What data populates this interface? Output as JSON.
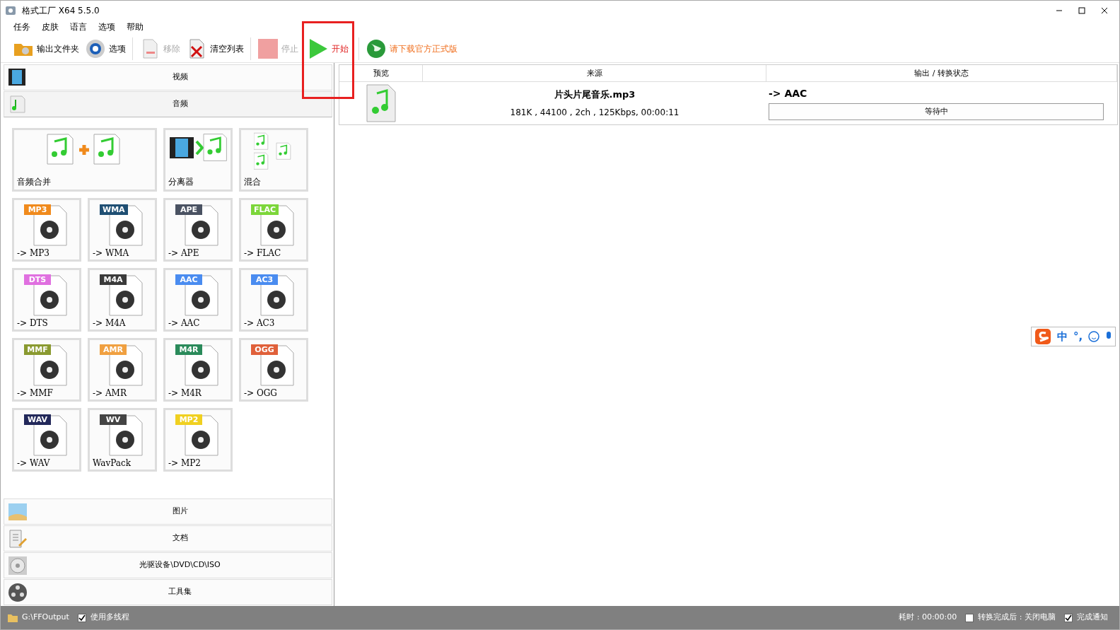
{
  "window": {
    "title": "格式工厂 X64 5.5.0"
  },
  "menu": [
    "任务",
    "皮肤",
    "语言",
    "选项",
    "帮助"
  ],
  "toolbar": [
    {
      "kind": "folder",
      "label": "输出文件夹",
      "disabled": false,
      "highlighted": false
    },
    {
      "kind": "gear",
      "label": "选项",
      "disabled": false,
      "highlighted": false
    },
    {
      "kind": "sep"
    },
    {
      "kind": "remove",
      "label": "移除",
      "disabled": true,
      "highlighted": false
    },
    {
      "kind": "clear",
      "label": "清空列表",
      "disabled": false,
      "highlighted": false
    },
    {
      "kind": "sep"
    },
    {
      "kind": "stop",
      "label": "停止",
      "disabled": true,
      "highlighted": false
    },
    {
      "kind": "start",
      "label": "开始",
      "disabled": false,
      "highlighted": true
    },
    {
      "kind": "sep"
    },
    {
      "kind": "globe",
      "label": "请下载官方正式版",
      "disabled": false,
      "highlighted": false
    }
  ],
  "sidebar": {
    "top_categories": [
      {
        "kind": "video",
        "label": "视频",
        "expanded": false
      },
      {
        "kind": "audio",
        "label": "音频",
        "expanded": true
      }
    ],
    "tiles": [
      {
        "kind": "merge",
        "label": "音频合并"
      },
      {
        "kind": "split",
        "label": "分离器"
      },
      {
        "kind": "mix",
        "label": "混合"
      },
      {
        "kind": "format",
        "label": "-> MP3",
        "badge": "MP3",
        "color": "#f08a1c"
      },
      {
        "kind": "format",
        "label": "-> WMA",
        "badge": "WMA",
        "color": "#1f4f73"
      },
      {
        "kind": "format",
        "label": "-> APE",
        "badge": "APE",
        "color": "#4a5262"
      },
      {
        "kind": "format",
        "label": "-> FLAC",
        "badge": "FLAC",
        "color": "#7cd63a"
      },
      {
        "kind": "format",
        "label": "-> DTS",
        "badge": "DTS",
        "color": "#e070e0"
      },
      {
        "kind": "format",
        "label": "-> M4A",
        "badge": "M4A",
        "color": "#3a3a3a"
      },
      {
        "kind": "format",
        "label": "-> AAC",
        "badge": "AAC",
        "color": "#4a8cf0"
      },
      {
        "kind": "format",
        "label": "-> AC3",
        "badge": "AC3",
        "color": "#4a8cf0"
      },
      {
        "kind": "format",
        "label": "-> MMF",
        "badge": "MMF",
        "color": "#8a9a30"
      },
      {
        "kind": "format",
        "label": "-> AMR",
        "badge": "AMR",
        "color": "#f0a040"
      },
      {
        "kind": "format",
        "label": "-> M4R",
        "badge": "M4R",
        "color": "#2a8a5a"
      },
      {
        "kind": "format",
        "label": "-> OGG",
        "badge": "OGG",
        "color": "#e0603a"
      },
      {
        "kind": "format",
        "label": "-> WAV",
        "badge": "WAV",
        "color": "#22285a"
      },
      {
        "kind": "format",
        "label": "WavPack",
        "badge": "WV",
        "color": "#444444"
      },
      {
        "kind": "format",
        "label": "-> MP2",
        "badge": "MP2",
        "color": "#f0d020"
      }
    ],
    "bottom_categories": [
      {
        "kind": "picture",
        "label": "图片"
      },
      {
        "kind": "document",
        "label": "文档"
      },
      {
        "kind": "disc",
        "label": "光驱设备\\DVD\\CD\\ISO"
      },
      {
        "kind": "tools",
        "label": "工具集"
      }
    ]
  },
  "table": {
    "columns": [
      "预览",
      "来源",
      "输出 / 转换状态"
    ],
    "rows": [
      {
        "file": "片头片尾音乐.mp3",
        "info": "181K , 44100 , 2ch , 125Kbps, 00:00:11",
        "output": "-> AAC",
        "status": "等待中"
      }
    ]
  },
  "ime": {
    "label": "中",
    "punct": "°,"
  },
  "status_bar": {
    "folder": "G:\\FFOutput",
    "multithread": {
      "label": "使用多线程",
      "checked": true
    },
    "elapsed": "耗时 : 00:00:00",
    "shutdown": {
      "label": "转换完成后 : 关闭电脑",
      "checked": false
    },
    "notify": {
      "label": "完成通知",
      "checked": true
    }
  }
}
